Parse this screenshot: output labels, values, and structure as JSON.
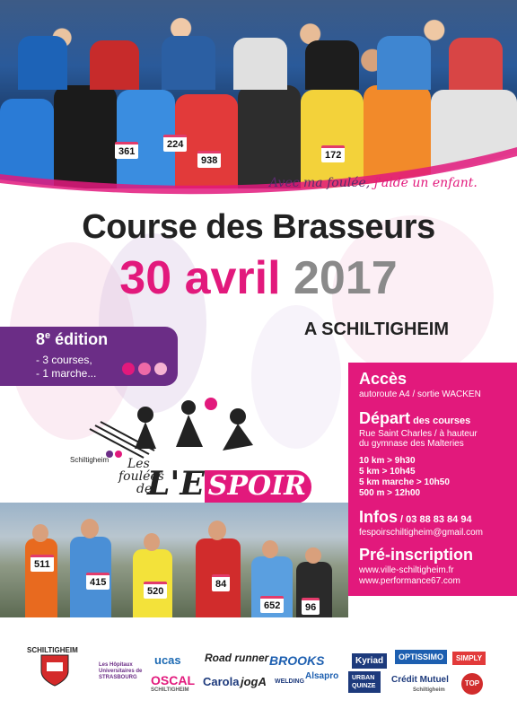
{
  "slogan": {
    "part1": "Avec ma foulée,",
    "part2": "j'aide un enfant."
  },
  "event": {
    "title": "Course des Brasseurs",
    "date_day": "30 avril",
    "date_year": "2017",
    "city": "A SCHILTIGHEIM"
  },
  "edition": {
    "title": "8",
    "title_sup": "e",
    "title_rest": " édition",
    "line1": "- 3 courses,",
    "line2": "- 1 marche..."
  },
  "logo": {
    "town": "Schiltigheim",
    "les": "Les",
    "foulees": "foulées",
    "de": "de",
    "espoir_l": "L'E",
    "espoir_rest": "SPOIR"
  },
  "runner_bibs": {
    "top": [
      "224",
      "938",
      "361",
      "172"
    ],
    "bottom": [
      "415",
      "520",
      "84",
      "652",
      "96",
      "511"
    ]
  },
  "info": {
    "acces_title": "Accès",
    "acces_text": "autoroute A4 / sortie WACKEN",
    "depart_title": "Départ",
    "depart_suffix": " des courses",
    "depart_line1": "Rue Saint Charles / à hauteur",
    "depart_line2": "du gymnase des Malteries",
    "schedule": [
      "10 km > 9h30",
      "5 km > 10h45",
      "5 km marche > 10h50",
      "500 m > 12h00"
    ],
    "infos_title": "Infos",
    "infos_phone": " / 03 88 83 84 94",
    "infos_email": "fespoirschiltigheim@gmail.com",
    "preinscription_title": "Pré-inscription",
    "site1": "www.ville-schiltigheim.fr",
    "site2": "www.performance67.com"
  },
  "sponsors": {
    "schiltigheim": "SCHILTIGHEIM",
    "hopitaux": "Les Hôpitaux Universitaires de STRASBOURG",
    "ucas": "ucas",
    "oscal": "OSCAL",
    "oscal_sub": "SCHILTIGHEIM",
    "road_runner": "Road runner",
    "carola": "Carola",
    "joga": "jogA",
    "brooks": "BROOKS",
    "welding": "WELDING",
    "alsapro": "Alsapro",
    "kyriad": "Kyriad",
    "urban_quinze": "URBAN QUINZE",
    "optissimo": "OPTISSIMO",
    "credit_mutuel": "Crédit Mutuel",
    "credit_mutuel_sub": "Schiltigheim",
    "simply": "SIMPLY",
    "top": "TOP"
  },
  "colors": {
    "pink": "#e2197c",
    "purple": "#6b2d86",
    "grey": "#8a8a8a"
  }
}
